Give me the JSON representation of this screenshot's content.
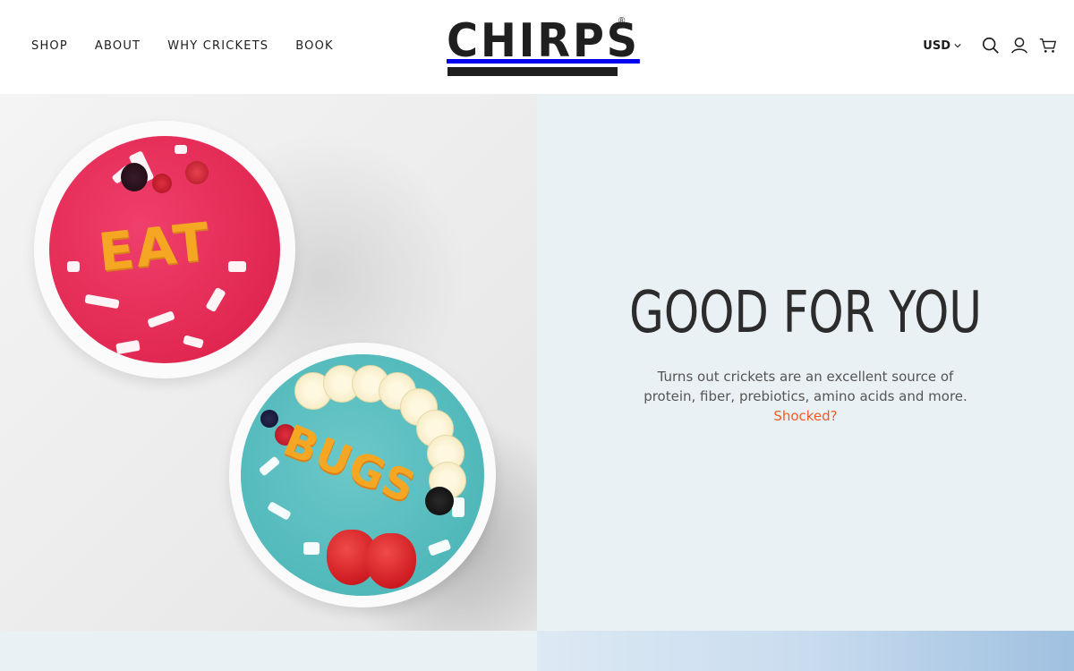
{
  "nav": {
    "items": [
      {
        "label": "SHOP"
      },
      {
        "label": "ABOUT"
      },
      {
        "label": "WHY CRICKETS"
      },
      {
        "label": "BOOK"
      }
    ]
  },
  "brand": {
    "name": "CHIRPS",
    "registered": "®"
  },
  "header_tools": {
    "currency": "USD",
    "icons": [
      "search-icon",
      "account-icon",
      "cart-icon"
    ]
  },
  "hero": {
    "image_words": [
      "EAT",
      "BUGS"
    ],
    "headline": "GOOD FOR YOU",
    "body": "Turns out crickets are an excellent source of protein, fiber, prebiotics, amino acids and more.",
    "link_label": "Shocked?"
  },
  "colors": {
    "accent": "#f05a22",
    "panel_bg": "#eaf1f4",
    "text_dark": "#2c2c2c"
  }
}
